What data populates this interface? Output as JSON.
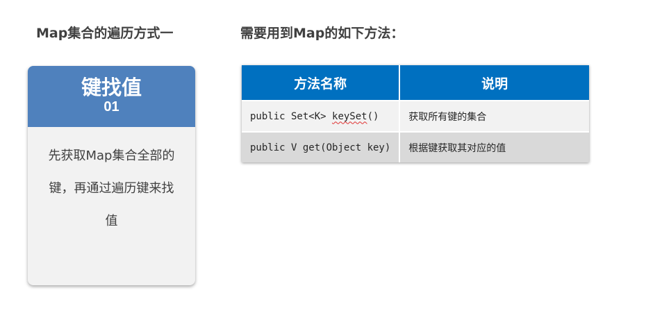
{
  "left_heading": "Map集合的遍历方式一",
  "right_heading": "需要用到Map的如下方法：",
  "card": {
    "title": "键找值",
    "number": "01",
    "description_lines": [
      "先获取Map集合全部的",
      "键，再通过遍历键来找",
      "值"
    ]
  },
  "table": {
    "headers": [
      "方法名称",
      "说明"
    ],
    "rows": [
      {
        "method_prefix": "public Set<K> ",
        "method_name": "keySet",
        "method_suffix": "()",
        "description": "获取所有键的集合"
      },
      {
        "method": "public V get(Object key)",
        "description": "根据键获取其对应的值"
      }
    ]
  },
  "colors": {
    "card_header": "#4f81bd",
    "table_header": "#0070c0",
    "row_light": "#f2f2f2",
    "row_dark": "#d9d9d9"
  }
}
